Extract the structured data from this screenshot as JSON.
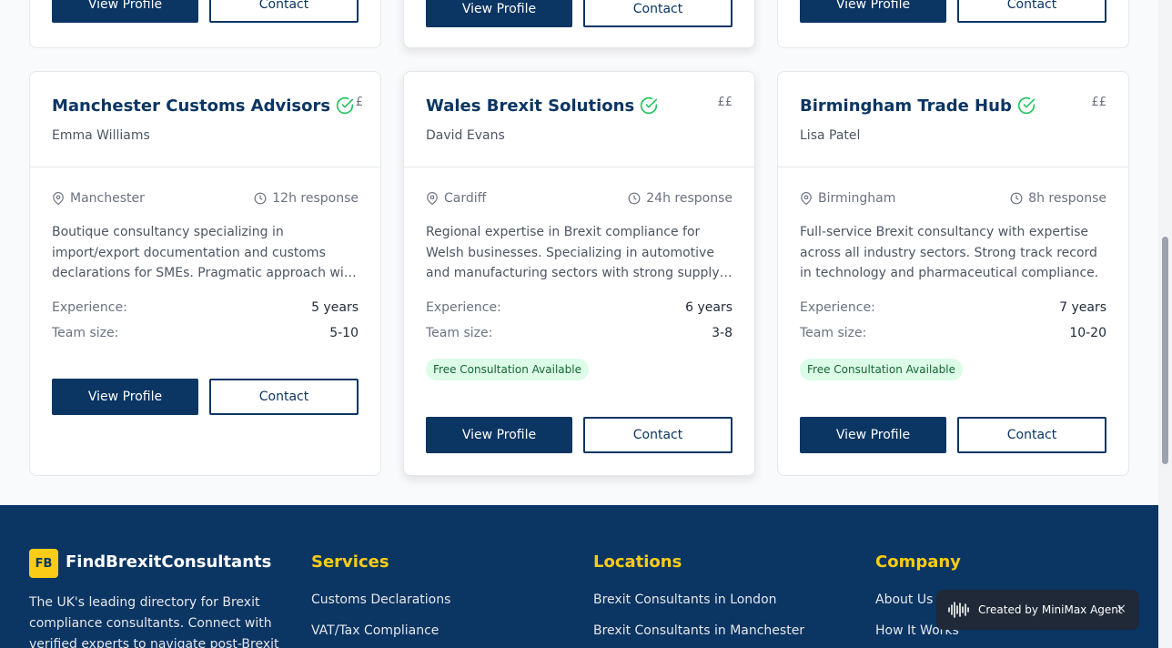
{
  "top_cards": [
    {
      "view_label": "View Profile",
      "contact_label": "Contact"
    },
    {
      "view_label": "View Profile",
      "contact_label": "Contact"
    },
    {
      "view_label": "View Profile",
      "contact_label": "Contact"
    }
  ],
  "cards": [
    {
      "name": "Manchester Customs Advisors",
      "price": "£",
      "person": "Emma Williams",
      "location": "Manchester",
      "response": "12h response",
      "description": "Boutique consultancy specializing in import/export documentation and customs declarations for SMEs. Pragmatic approach with competitive rates for small businesses.",
      "experience_label": "Experience:",
      "experience": "5 years",
      "team_label": "Team size:",
      "team": "5-10",
      "view_label": "View Profile",
      "contact_label": "Contact"
    },
    {
      "name": "Wales Brexit Solutions",
      "price": "££",
      "person": "David Evans",
      "location": "Cardiff",
      "response": "24h response",
      "description": "Regional expertise in Brexit compliance for Welsh businesses. Specializing in automotive and manufacturing sectors with strong supply chain knowledge.",
      "experience_label": "Experience:",
      "experience": "6 years",
      "team_label": "Team size:",
      "team": "3-8",
      "badge": "Free Consultation Available",
      "view_label": "View Profile",
      "contact_label": "Contact"
    },
    {
      "name": "Birmingham Trade Hub",
      "price": "££",
      "person": "Lisa Patel",
      "location": "Birmingham",
      "response": "8h response",
      "description": "Full-service Brexit consultancy with expertise across all industry sectors. Strong track record in technology and pharmaceutical compliance.",
      "experience_label": "Experience:",
      "experience": "7 years",
      "team_label": "Team size:",
      "team": "10-20",
      "badge": "Free Consultation Available",
      "view_label": "View Profile",
      "contact_label": "Contact"
    }
  ],
  "footer": {
    "logo": "FB",
    "brand": "FindBrexitConsultants",
    "description": "The UK's leading directory for Brexit compliance consultants. Connect with verified experts to navigate post-Brexit",
    "services": {
      "title": "Services",
      "links": [
        "Customs Declarations",
        "VAT/Tax Compliance"
      ]
    },
    "locations": {
      "title": "Locations",
      "links": [
        "Brexit Consultants in London",
        "Brexit Consultants in Manchester"
      ]
    },
    "company": {
      "title": "Company",
      "links": [
        "About Us",
        "How It Works"
      ]
    }
  },
  "minimax": {
    "label": "Created by MiniMax Agent",
    "close": "×"
  },
  "colors": {
    "primary": "#0b3563",
    "accent": "#facc15",
    "verified": "#22c55e",
    "badge_bg": "#dcfce7"
  }
}
